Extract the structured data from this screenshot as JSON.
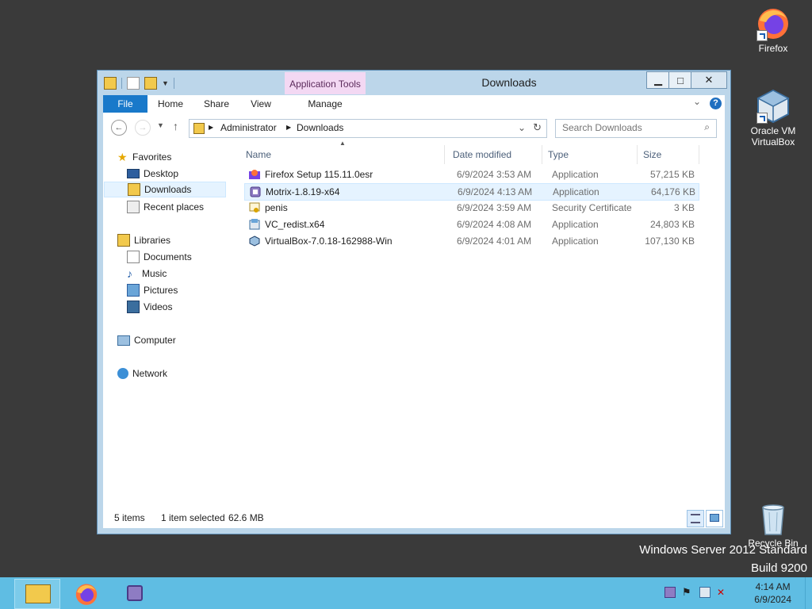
{
  "desktop": {
    "icons": [
      {
        "label": "Firefox"
      },
      {
        "label": "Oracle VM VirtualBox"
      },
      {
        "label": "Recycle Bin"
      }
    ],
    "watermark": {
      "line1": "Windows Server 2012 Standard",
      "line2": "Build 9200"
    }
  },
  "window": {
    "title": "Downloads",
    "context_tab": "Application Tools",
    "ribbon_tabs": [
      "File",
      "Home",
      "Share",
      "View",
      "Manage"
    ],
    "address": {
      "crumbs": [
        "Administrator",
        "Downloads"
      ]
    },
    "search": {
      "placeholder": "Search Downloads"
    },
    "nav": {
      "favorites": {
        "label": "Favorites",
        "items": [
          "Desktop",
          "Downloads",
          "Recent places"
        ]
      },
      "libraries": {
        "label": "Libraries",
        "items": [
          "Documents",
          "Music",
          "Pictures",
          "Videos"
        ]
      },
      "computer": "Computer",
      "network": "Network",
      "selected": "Downloads"
    },
    "columns": [
      "Name",
      "Date modified",
      "Type",
      "Size"
    ],
    "files": [
      {
        "name": "Firefox Setup 115.11.0esr",
        "date": "6/9/2024 3:53 AM",
        "type": "Application",
        "size": "57,215 KB",
        "icon": "firefox-installer-icon"
      },
      {
        "name": "Motrix-1.8.19-x64",
        "date": "6/9/2024 4:13 AM",
        "type": "Application",
        "size": "64,176 KB",
        "icon": "motrix-icon"
      },
      {
        "name": "penis",
        "date": "6/9/2024 3:59 AM",
        "type": "Security Certificate",
        "size": "3 KB",
        "icon": "certificate-icon"
      },
      {
        "name": "VC_redist.x64",
        "date": "6/9/2024 4:08 AM",
        "type": "Application",
        "size": "24,803 KB",
        "icon": "installer-icon"
      },
      {
        "name": "VirtualBox-7.0.18-162988-Win",
        "date": "6/9/2024 4:01 AM",
        "type": "Application",
        "size": "107,130 KB",
        "icon": "virtualbox-icon"
      }
    ],
    "selected_file": "Motrix-1.8.19-x64",
    "status": {
      "items": "5 items",
      "selected": "1 item selected",
      "size": "62.6 MB"
    }
  },
  "taskbar": {
    "clock": {
      "time": "4:14 AM",
      "date": "6/9/2024"
    }
  },
  "colors": {
    "accent": "#1979ca",
    "taskbar": "#5fbde3",
    "context_tab": "#f3d8f3",
    "selection": "#e5f3ff"
  }
}
